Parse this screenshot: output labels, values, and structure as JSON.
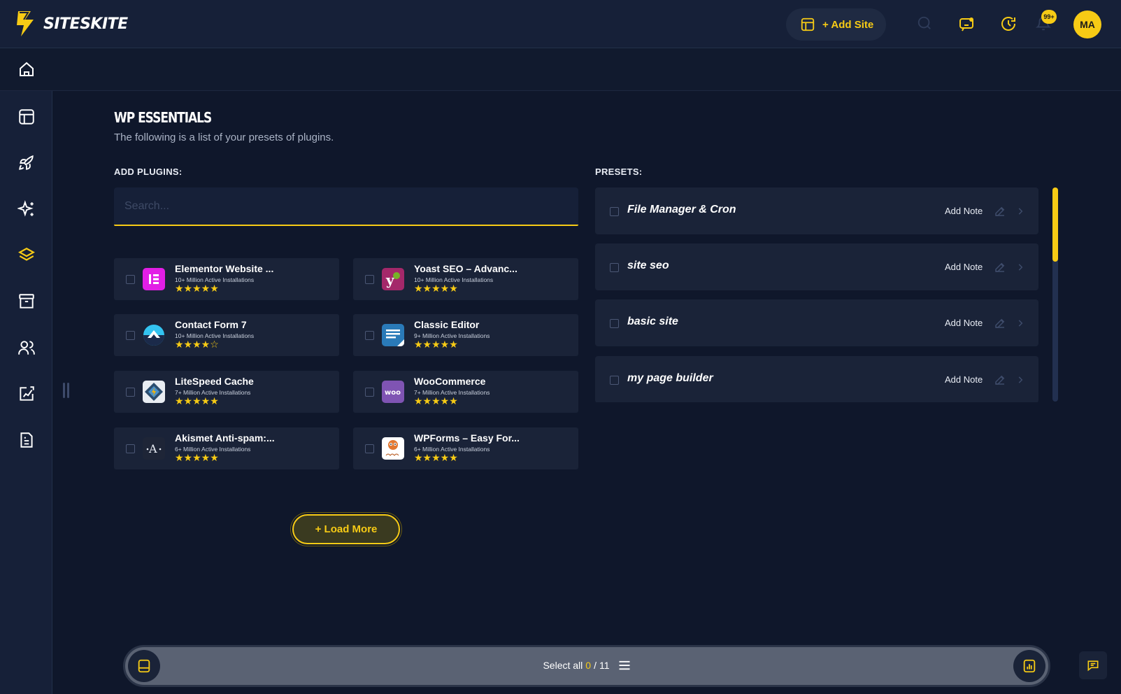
{
  "app": {
    "name": "SITESKITE"
  },
  "header": {
    "add_site_label": "+ Add Site",
    "notification_count": "99+",
    "avatar_initials": "MA"
  },
  "page": {
    "title": "WP ESSENTIALS",
    "subtitle": "The following is a list of your presets of plugins.",
    "add_plugins_label": "ADD PLUGINS:",
    "presets_label": "PRESETS:"
  },
  "search": {
    "placeholder": "Search..."
  },
  "plugins": [
    {
      "name": "Elementor Website ...",
      "installs": "10+ Million Active Installations",
      "stars": "★★★★★",
      "icon": "elementor-icon"
    },
    {
      "name": "Yoast SEO – Advanc...",
      "installs": "10+ Million Active Installations",
      "stars": "★★★★★",
      "icon": "yoast-icon"
    },
    {
      "name": "Contact Form 7",
      "installs": "10+ Million Active Installations",
      "stars": "★★★★☆",
      "icon": "contact-form-icon"
    },
    {
      "name": "Classic Editor",
      "installs": "9+ Million Active Installations",
      "stars": "★★★★★",
      "icon": "classic-editor-icon"
    },
    {
      "name": "LiteSpeed Cache",
      "installs": "7+ Million Active Installations",
      "stars": "★★★★★",
      "icon": "litespeed-icon"
    },
    {
      "name": "WooCommerce",
      "installs": "7+ Million Active Installations",
      "stars": "★★★★★",
      "icon": "woocommerce-icon"
    },
    {
      "name": "Akismet Anti-spam:...",
      "installs": "6+ Million Active Installations",
      "stars": "★★★★★",
      "icon": "akismet-icon"
    },
    {
      "name": "WPForms – Easy For...",
      "installs": "6+ Million Active Installations",
      "stars": "★★★★★",
      "icon": "wpforms-icon"
    }
  ],
  "load_more_label": "+ Load More",
  "presets": [
    {
      "title": "File Manager & Cron",
      "note_label": "Add Note"
    },
    {
      "title": "site seo",
      "note_label": "Add Note"
    },
    {
      "title": "basic site",
      "note_label": "Add Note"
    },
    {
      "title": "my page builder",
      "note_label": "Add Note"
    }
  ],
  "bottom_bar": {
    "select_all_label": "Select all",
    "selected_count": "0",
    "separator": "/",
    "total_count": "11"
  },
  "colors": {
    "accent": "#f7cb15",
    "background": "#0f172b",
    "panel": "#1a2338"
  }
}
